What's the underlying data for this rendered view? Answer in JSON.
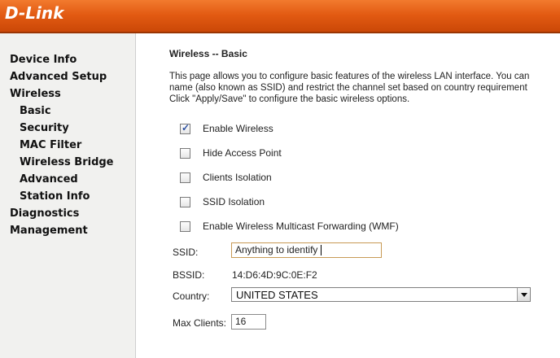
{
  "brand": {
    "logo_text": "D-Link",
    "banner_color": "#e25a12"
  },
  "sidebar": {
    "items": [
      {
        "label": "Device Info",
        "level": 0
      },
      {
        "label": "Advanced Setup",
        "level": 0
      },
      {
        "label": "Wireless",
        "level": 0
      },
      {
        "label": "Basic",
        "level": 1
      },
      {
        "label": "Security",
        "level": 1
      },
      {
        "label": "MAC Filter",
        "level": 1
      },
      {
        "label": "Wireless Bridge",
        "level": 1
      },
      {
        "label": "Advanced",
        "level": 1
      },
      {
        "label": "Station Info",
        "level": 1
      },
      {
        "label": "Diagnostics",
        "level": 0
      },
      {
        "label": "Management",
        "level": 0
      }
    ]
  },
  "main": {
    "title": "Wireless -- Basic",
    "description_lines": [
      "This page allows you to configure basic features of the wireless LAN interface. You can",
      "name (also known as SSID) and restrict the channel set based on country requirement",
      "Click \"Apply/Save\" to configure the basic wireless options."
    ],
    "options": [
      {
        "label": "Enable Wireless",
        "checked": true
      },
      {
        "label": "Hide Access Point",
        "checked": false
      },
      {
        "label": "Clients Isolation",
        "checked": false
      },
      {
        "label": "SSID Isolation",
        "checked": false
      },
      {
        "label": "Enable Wireless Multicast Forwarding (WMF)",
        "checked": false
      }
    ],
    "ssid": {
      "label": "SSID:",
      "value": "Anything to identify"
    },
    "bssid": {
      "label": "BSSID:",
      "value": "14:D6:4D:9C:0E:F2"
    },
    "country": {
      "label": "Country:",
      "value": "UNITED STATES"
    },
    "max_clients": {
      "label": "Max Clients:",
      "value": "16"
    }
  }
}
